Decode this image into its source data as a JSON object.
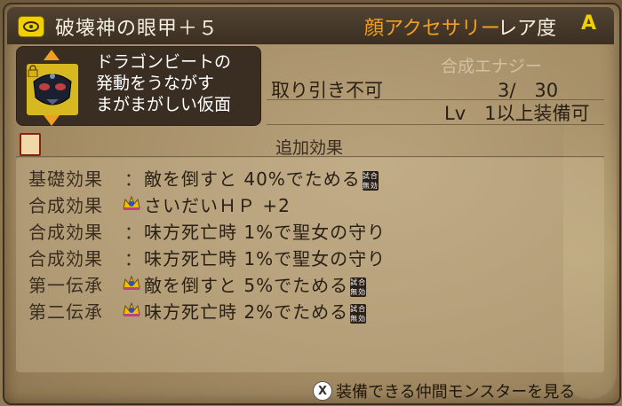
{
  "item": {
    "name": "破壊神の眼甲＋５",
    "category": "顔アクセサリー",
    "rarity_label": "レア度",
    "rarity_value": "A",
    "description": [
      "ドラゴンビートの",
      "発動をうながす",
      "まがまがしい仮面"
    ],
    "trade": "取り引き不可",
    "synthesis_label": "合成エナジー",
    "synthesis_value": "3/　30",
    "requirement": "Lv　1以上装備可"
  },
  "section": {
    "header": "追加効果"
  },
  "effects": [
    {
      "label": "基礎効果",
      "crown": false,
      "text": "敵を倒すと 40%でためる",
      "badge": true
    },
    {
      "label": "合成効果",
      "crown": true,
      "text": "さいだいＨＰ +2",
      "badge": false
    },
    {
      "label": "合成効果",
      "crown": false,
      "text": "味方死亡時 1%で聖女の守り",
      "badge": false
    },
    {
      "label": "合成効果",
      "crown": false,
      "text": "味方死亡時 1%で聖女の守り",
      "badge": false
    },
    {
      "label": "第一伝承",
      "crown": true,
      "text": "敵を倒すと 5%でためる",
      "badge": true
    },
    {
      "label": "第二伝承",
      "crown": true,
      "text": "味方死亡時 2%でためる",
      "badge": true
    }
  ],
  "colon": "：",
  "badge_text": [
    "試合",
    "無効"
  ],
  "footer": {
    "button": "X",
    "text": "装備できる仲間モンスターを見る"
  },
  "colors": {
    "accent_orange": "#f0a020",
    "gold": "#f0d000",
    "panel_dark": "#3a2d22"
  }
}
